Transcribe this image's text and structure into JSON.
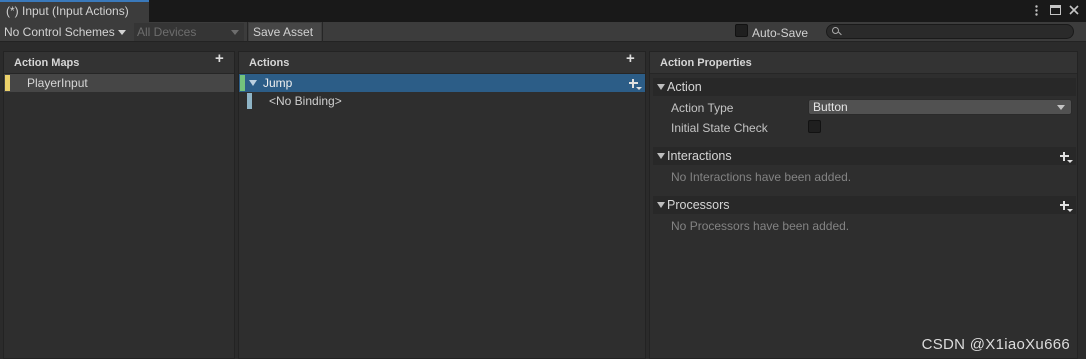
{
  "window": {
    "tab_title": "(*) Input (Input Actions)",
    "menu_icon": "kebab-menu-icon",
    "maximize_icon": "maximize-icon",
    "close_icon": "close-icon"
  },
  "toolbar": {
    "control_schemes": "No Control Schemes",
    "devices": "All Devices",
    "save_asset": "Save Asset",
    "auto_save_label": "Auto-Save",
    "auto_save_checked": false,
    "search_value": ""
  },
  "action_maps": {
    "header": "Action Maps",
    "items": [
      {
        "label": "PlayerInput",
        "color": "#ebd16a"
      }
    ]
  },
  "actions": {
    "header": "Actions",
    "items": [
      {
        "label": "Jump",
        "selected": true,
        "color": "#73c27c",
        "bindings": [
          {
            "label": "<No Binding>",
            "color": "#8eb4c6"
          }
        ]
      }
    ]
  },
  "properties": {
    "header": "Action Properties",
    "action_section": {
      "title": "Action",
      "action_type_label": "Action Type",
      "action_type_value": "Button",
      "initial_state_label": "Initial State Check",
      "initial_state_checked": false
    },
    "interactions": {
      "title": "Interactions",
      "empty": "No Interactions have been added."
    },
    "processors": {
      "title": "Processors",
      "empty": "Processors have been added."
    }
  },
  "watermark": "CSDN @X1iaoXu666",
  "colors": {
    "accent": "#3a79bb",
    "selection": "#2c5d87"
  }
}
